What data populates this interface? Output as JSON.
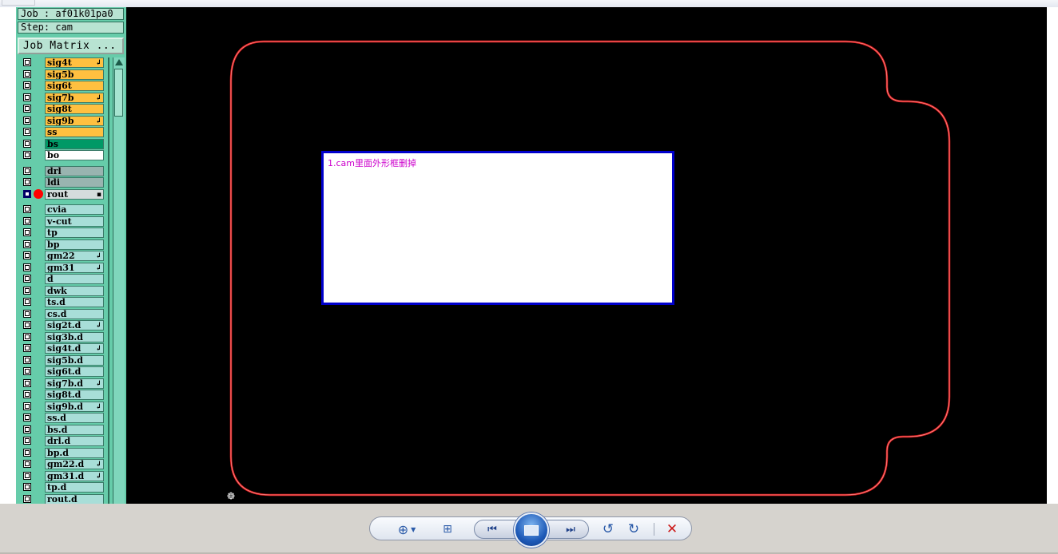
{
  "panel": {
    "job_label": "Job : af01k01pa0",
    "step_label": "Step: cam",
    "job_matrix_button": "Job Matrix ..."
  },
  "layers_board": [
    {
      "name": "sig4t",
      "color": "orange",
      "mark": "↲"
    },
    {
      "name": "sig5b",
      "color": "orange",
      "mark": ""
    },
    {
      "name": "sig6t",
      "color": "orange",
      "mark": ""
    },
    {
      "name": "sig7b",
      "color": "orange",
      "mark": "↲"
    },
    {
      "name": "sig8t",
      "color": "orange",
      "mark": ""
    },
    {
      "name": "sig9b",
      "color": "orange",
      "mark": "↲"
    },
    {
      "name": "ss",
      "color": "orange",
      "mark": ""
    },
    {
      "name": "bs",
      "color": "green",
      "mark": ""
    },
    {
      "name": "bo",
      "color": "white",
      "mark": ""
    }
  ],
  "layers_drill": [
    {
      "name": "drl",
      "color": "gray",
      "mark": "",
      "selected": false
    },
    {
      "name": "ldi",
      "color": "gray",
      "mark": "",
      "selected": false
    },
    {
      "name": "rout",
      "color": "light",
      "mark": "▪",
      "selected": true
    }
  ],
  "layers_misc": [
    {
      "name": "cvia",
      "mark": ""
    },
    {
      "name": "v-cut",
      "mark": ""
    },
    {
      "name": "tp",
      "mark": ""
    },
    {
      "name": "bp",
      "mark": ""
    },
    {
      "name": "gm22",
      "mark": "↲"
    },
    {
      "name": "gm31",
      "mark": "↲"
    },
    {
      "name": "d",
      "mark": ""
    },
    {
      "name": "dwk",
      "mark": ""
    },
    {
      "name": "ts.d",
      "mark": ""
    },
    {
      "name": "cs.d",
      "mark": ""
    },
    {
      "name": "sig2t.d",
      "mark": "↲"
    },
    {
      "name": "sig3b.d",
      "mark": ""
    },
    {
      "name": "sig4t.d",
      "mark": "↲"
    },
    {
      "name": "sig5b.d",
      "mark": ""
    },
    {
      "name": "sig6t.d",
      "mark": ""
    },
    {
      "name": "sig7b.d",
      "mark": "↲"
    },
    {
      "name": "sig8t.d",
      "mark": ""
    },
    {
      "name": "sig9b.d",
      "mark": "↲"
    },
    {
      "name": "ss.d",
      "mark": ""
    },
    {
      "name": "bs.d",
      "mark": ""
    },
    {
      "name": "drl.d",
      "mark": ""
    },
    {
      "name": "bp.d",
      "mark": ""
    },
    {
      "name": "gm22.d",
      "mark": "↲"
    },
    {
      "name": "gm31.d",
      "mark": "↲"
    },
    {
      "name": "tp.d",
      "mark": ""
    },
    {
      "name": "rout.d",
      "mark": ""
    }
  ],
  "canvas": {
    "note_text": "1.cam里面外形框删掉",
    "outline_color": "#e02020",
    "background": "#000000",
    "datum_icon": "datum-crosshair-icon"
  },
  "toolbar": {
    "zoom_icon": "zoom-in-icon",
    "fit_icon": "actual-size-icon",
    "prev_icon": "previous-icon",
    "slideshow_icon": "slideshow-icon",
    "next_icon": "next-icon",
    "rotate_ccw_icon": "rotate-counterclockwise-icon",
    "rotate_cw_icon": "rotate-clockwise-icon",
    "delete_icon": "delete-icon"
  }
}
